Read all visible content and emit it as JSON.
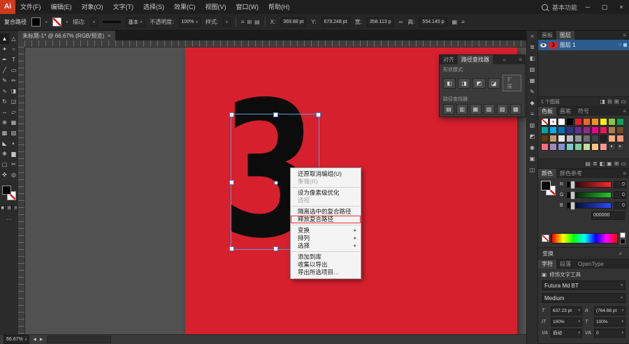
{
  "colors": {
    "artboard_red": "#d6202e",
    "selection_blue": "#5b9bd5",
    "highlight_red": "#e53030",
    "layer_row_blue": "#2b5c8e"
  },
  "icons": {
    "panel_menu": "≡",
    "caret": "▾",
    "link": "∞",
    "collapse": "«",
    "target_circle": "○",
    "minimize": "─",
    "maximize": "▢",
    "close": "×",
    "tab_close": "×",
    "touch_type": "▣",
    "ellipsis": "…"
  },
  "menubar": {
    "logo": "Ai",
    "items": [
      "文件(F)",
      "编辑(E)",
      "对象(O)",
      "文字(T)",
      "选择(S)",
      "效果(C)",
      "视图(V)",
      "窗口(W)",
      "帮助(H)"
    ],
    "workspace": "基本功能"
  },
  "controlbar": {
    "selection_label": "复合路径",
    "stroke_label": "描边:",
    "brush_value": "基本",
    "opacity_label": "不透明度:",
    "opacity_value": "100%",
    "style_label": "样式:",
    "align_icons": [
      {
        "name": "align-horizontal-icon",
        "glyph": "≡"
      },
      {
        "name": "distribute-icon",
        "glyph": "⊞"
      },
      {
        "name": "boundingbox-icon",
        "glyph": "▤"
      }
    ],
    "x_label": "X:",
    "x_value": "369.88 pt",
    "y_label": "Y:",
    "y_value": "679.248 pt",
    "w_label": "宽:",
    "w_value": "358.113 p",
    "h_label": "高:",
    "h_value": "554.145 p",
    "right_icons": [
      {
        "name": "transform-panel-icon",
        "glyph": "▦"
      },
      {
        "name": "control-menu-icon",
        "glyph": "≡"
      }
    ]
  },
  "doc_tab": {
    "title": "未标题-1* @ 66.67% (RGB/预览)"
  },
  "tools": [
    {
      "name": "selection-tool",
      "glyph": "▲"
    },
    {
      "name": "direct-selection-tool",
      "glyph": "△"
    },
    {
      "name": "magic-wand-tool",
      "glyph": "✦"
    },
    {
      "name": "lasso-tool",
      "glyph": "○"
    },
    {
      "name": "pen-tool",
      "glyph": "✒"
    },
    {
      "name": "type-tool",
      "glyph": "T"
    },
    {
      "name": "line-segment-tool",
      "glyph": "╱"
    },
    {
      "name": "rectangle-tool",
      "glyph": "▭"
    },
    {
      "name": "paintbrush-tool",
      "glyph": "✎"
    },
    {
      "name": "pencil-tool",
      "glyph": "✏"
    },
    {
      "name": "shaper-tool",
      "glyph": "∿"
    },
    {
      "name": "eraser-tool",
      "glyph": "◨"
    },
    {
      "name": "rotate-tool",
      "glyph": "↻"
    },
    {
      "name": "scale-tool",
      "glyph": "◲"
    },
    {
      "name": "width-tool",
      "glyph": "↔"
    },
    {
      "name": "free-transform-tool",
      "glyph": "▱"
    },
    {
      "name": "shape-builder-tool",
      "glyph": "⊕"
    },
    {
      "name": "perspective-grid-tool",
      "glyph": "▦"
    },
    {
      "name": "mesh-tool",
      "glyph": "▩"
    },
    {
      "name": "gradient-tool",
      "glyph": "▧"
    },
    {
      "name": "eyedropper-tool",
      "glyph": "◣"
    },
    {
      "name": "blend-tool",
      "glyph": "◐"
    },
    {
      "name": "symbol-sprayer-tool",
      "glyph": "❋"
    },
    {
      "name": "column-graph-tool",
      "glyph": "▆"
    },
    {
      "name": "artboard-tool",
      "glyph": "▢"
    },
    {
      "name": "slice-tool",
      "glyph": "✂"
    },
    {
      "name": "hand-tool",
      "glyph": "✜"
    },
    {
      "name": "zoom-tool",
      "glyph": "◎"
    }
  ],
  "toolbar_modes": [
    {
      "name": "color-mode-icon",
      "glyph": "◼"
    },
    {
      "name": "gradient-mode-icon",
      "glyph": "▨"
    },
    {
      "name": "none-mode-icon",
      "glyph": "⊘"
    }
  ],
  "canvas_glyph": "3",
  "context_menu": [
    {
      "label": "还原取消编组(U)",
      "type": "normal"
    },
    {
      "label": "重做(R)",
      "type": "disabled"
    },
    {
      "type": "separator"
    },
    {
      "label": "设为像素级优化",
      "type": "normal"
    },
    {
      "label": "透视",
      "type": "disabled"
    },
    {
      "type": "separator"
    },
    {
      "label": "隔离选中的复合路径",
      "type": "normal"
    },
    {
      "label": "释放复合路径",
      "type": "highlighted"
    },
    {
      "type": "separator"
    },
    {
      "label": "变换",
      "type": "submenu"
    },
    {
      "label": "排列",
      "type": "submenu"
    },
    {
      "label": "选择",
      "type": "submenu"
    },
    {
      "type": "separator"
    },
    {
      "label": "添加到库",
      "type": "normal"
    },
    {
      "label": "收集以导出",
      "type": "normal"
    },
    {
      "label": "导出所选项目…",
      "type": "normal"
    }
  ],
  "pathfinder": {
    "tabs": [
      "对齐",
      "路径查找器"
    ],
    "shape_modes_label": "形状模式:",
    "expand_label": "扩展",
    "pathfinders_label": "路径查找器:",
    "shape_mode_buttons": [
      {
        "name": "unite-button",
        "glyph": "◧"
      },
      {
        "name": "minus-front-button",
        "glyph": "◨"
      },
      {
        "name": "intersect-button",
        "glyph": "◩"
      },
      {
        "name": "exclude-button",
        "glyph": "◪"
      }
    ],
    "pathfinder_buttons": [
      {
        "name": "divide-button",
        "glyph": "▤"
      },
      {
        "name": "trim-button",
        "glyph": "▥"
      },
      {
        "name": "merge-button",
        "glyph": "▦"
      },
      {
        "name": "crop-button",
        "glyph": "▧"
      },
      {
        "name": "outline-button",
        "glyph": "▨"
      },
      {
        "name": "minus-back-button",
        "glyph": "▩"
      }
    ]
  },
  "dock_icons": [
    {
      "name": "collapse-dock-icon",
      "glyph": "«"
    },
    {
      "name": "info-panel-icon",
      "glyph": "≣"
    },
    {
      "name": "color-panel-icon",
      "glyph": "◧"
    },
    {
      "name": "color-guide-panel-icon",
      "glyph": "▧"
    },
    {
      "name": "swatches-panel-icon",
      "glyph": "▦"
    },
    {
      "name": "brushes-panel-icon",
      "glyph": "✎"
    },
    {
      "name": "symbols-panel-icon",
      "glyph": "◆"
    },
    {
      "name": "stroke-panel-icon",
      "glyph": "≡"
    },
    {
      "name": "gradient-panel-icon",
      "glyph": "▥"
    },
    {
      "name": "transparency-panel-icon",
      "glyph": "◩"
    },
    {
      "name": "appearance-panel-icon",
      "glyph": "◉"
    },
    {
      "name": "graphic-styles-panel-icon",
      "glyph": "▣"
    },
    {
      "name": "pathfinder-panel-icon",
      "glyph": "◫"
    }
  ],
  "layers_panel": {
    "tabs": [
      "画板",
      "图层"
    ],
    "layer_name": "图层 1",
    "footer_text": "1 个图层",
    "footer_icons": [
      {
        "name": "make-clipping-mask-icon",
        "glyph": "◨"
      },
      {
        "name": "new-sublayer-icon",
        "glyph": "⊟"
      },
      {
        "name": "new-layer-icon",
        "glyph": "⊞"
      },
      {
        "name": "delete-layer-icon",
        "glyph": "▭"
      }
    ]
  },
  "swatches_panel": {
    "tabs": [
      "色板",
      "画笔",
      "符号"
    ],
    "grid": [
      {
        "type": "none"
      },
      {
        "type": "reg"
      },
      {
        "type": "color",
        "hex": "#ffffff"
      },
      {
        "type": "color",
        "hex": "#000000"
      },
      {
        "type": "color",
        "hex": "#ed1c24"
      },
      {
        "type": "color",
        "hex": "#f26522"
      },
      {
        "type": "color",
        "hex": "#f7941d"
      },
      {
        "type": "color",
        "hex": "#fff200"
      },
      {
        "type": "color",
        "hex": "#8dc63f"
      },
      {
        "type": "color",
        "hex": "#00a651"
      },
      {
        "type": "color",
        "hex": "#00a99d"
      },
      {
        "type": "color",
        "hex": "#00aeef"
      },
      {
        "type": "color",
        "hex": "#0072bc"
      },
      {
        "type": "color",
        "hex": "#2e3192"
      },
      {
        "type": "color",
        "hex": "#662d91"
      },
      {
        "type": "color",
        "hex": "#92278f"
      },
      {
        "type": "color",
        "hex": "#ec008c"
      },
      {
        "type": "color",
        "hex": "#ed145b"
      },
      {
        "type": "color",
        "hex": "#a97c50"
      },
      {
        "type": "color",
        "hex": "#754c24"
      },
      {
        "type": "color",
        "hex": "#603913"
      },
      {
        "type": "color",
        "hex": "#c69c6d"
      },
      {
        "type": "color",
        "hex": "#e6e7e8"
      },
      {
        "type": "color",
        "hex": "#bcbec0"
      },
      {
        "type": "color",
        "hex": "#939598"
      },
      {
        "type": "color",
        "hex": "#6d6e71"
      },
      {
        "type": "color",
        "hex": "#414042"
      },
      {
        "type": "color",
        "hex": "#231f20"
      },
      {
        "type": "color",
        "hex": "#f9ad81"
      },
      {
        "type": "color",
        "hex": "#f69679"
      },
      {
        "type": "color",
        "hex": "#f26d7d"
      },
      {
        "type": "color",
        "hex": "#a186be"
      },
      {
        "type": "color",
        "hex": "#8393ca"
      },
      {
        "type": "color",
        "hex": "#7accc8"
      },
      {
        "type": "color",
        "hex": "#82ca9c"
      },
      {
        "type": "color",
        "hex": "#c4df9b"
      },
      {
        "type": "color",
        "hex": "#fdc689"
      },
      {
        "type": "color",
        "hex": "#f5989d"
      },
      {
        "type": "group"
      },
      {
        "type": "group"
      }
    ],
    "footer_icons": [
      {
        "name": "swatch-libraries-icon",
        "glyph": "▤"
      },
      {
        "name": "swatch-kinds-icon",
        "glyph": "≣"
      },
      {
        "name": "swatch-options-icon",
        "glyph": "◧"
      },
      {
        "name": "new-color-group-icon",
        "glyph": "▣"
      },
      {
        "name": "new-swatch-icon",
        "glyph": "⊞"
      },
      {
        "name": "delete-swatch-icon",
        "glyph": "▭"
      }
    ]
  },
  "color_panel": {
    "tabs": [
      "颜色",
      "颜色参考"
    ],
    "sliders": [
      {
        "channel": "R",
        "value": "0",
        "hex": "#ff2a2a"
      },
      {
        "channel": "G",
        "value": "0",
        "hex": "#27c42a"
      },
      {
        "channel": "B",
        "value": "0",
        "hex": "#2a4bff"
      }
    ],
    "hex_value": "000000"
  },
  "transform_panel": {
    "title": "变换"
  },
  "character_panel": {
    "tabs": [
      "字符",
      "段落",
      "OpenType"
    ],
    "touch_tool_label": "修饰文字工具",
    "font_family": "Futura Md BT",
    "font_style": "Medium",
    "fields": [
      {
        "name": "font-size",
        "glyph": "T",
        "value": "637.23 pt"
      },
      {
        "name": "leading",
        "glyph": "A",
        "value": "(764.68 pt"
      },
      {
        "name": "vertical-scale",
        "glyph": "IT",
        "value": "100%"
      },
      {
        "name": "horizontal-scale",
        "glyph": "T",
        "value": "100%"
      },
      {
        "name": "kerning",
        "glyph": "VA",
        "value": "自动"
      },
      {
        "name": "tracking",
        "glyph": "VA",
        "value": "0"
      }
    ]
  },
  "statusbar": {
    "zoom": "66.67%"
  }
}
